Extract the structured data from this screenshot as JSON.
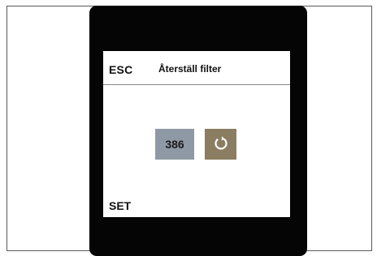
{
  "header": {
    "esc_label": "ESC",
    "title": "Återställ filter"
  },
  "main": {
    "filter_value": "386",
    "reset_icon": "reset-icon"
  },
  "footer": {
    "set_label": "SET"
  },
  "colors": {
    "value_box": "#8f99a6",
    "reset_button": "#8a7d61",
    "device_frame": "#050505"
  }
}
